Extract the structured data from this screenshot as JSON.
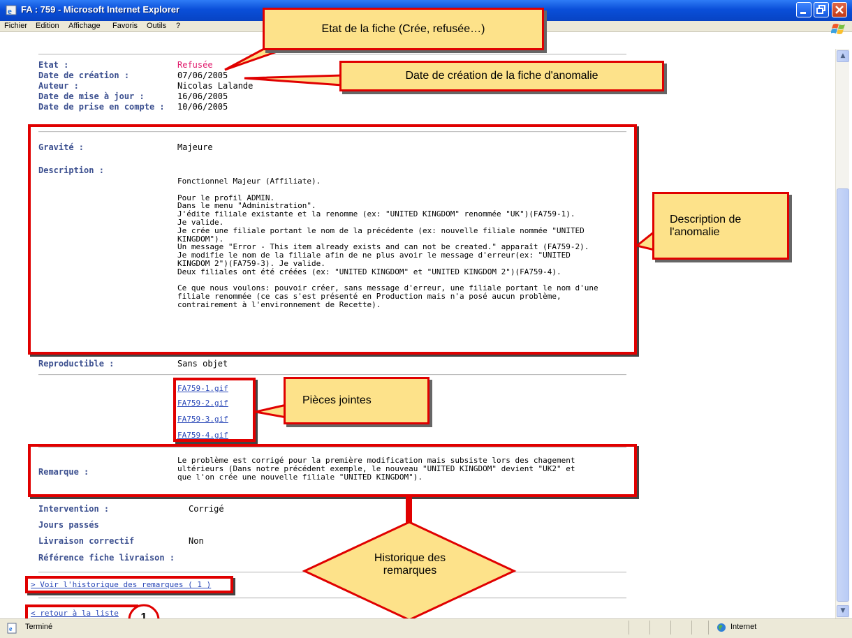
{
  "window": {
    "title": "FA : 759 - Microsoft Internet Explorer"
  },
  "menu": [
    "Fichier",
    "Edition",
    "Affichage",
    "Favoris",
    "Outils",
    "?"
  ],
  "fields_top": {
    "etat": {
      "label": "Etat :",
      "value": "Refusée",
      "color": "#e0196b"
    },
    "date_creation": {
      "label": "Date de création :",
      "value": "07/06/2005"
    },
    "auteur": {
      "label": "Auteur :",
      "value": "Nicolas Lalande"
    },
    "date_maj": {
      "label": "Date de mise à jour :",
      "value": "16/06/2005"
    },
    "date_prise": {
      "label": "Date de prise en compte :",
      "value": "10/06/2005"
    }
  },
  "gravite": {
    "label": "Gravité :",
    "value": "Majeure"
  },
  "description": {
    "label": "Description :",
    "text": "Fonctionnel Majeur (Affiliate).\n\nPour le profil ADMIN.\nDans le menu \"Administration\".\nJ'édite filiale existante et la renomme (ex: \"UNITED KINGDOM\" renommée \"UK\")(FA759-1).\nJe valide.\nJe crée une filiale portant le nom de la précédente (ex: nouvelle filiale nommée \"UNITED\nKINGDOM\").\nUn message \"Error - This item already exists and can not be created.\" apparaît (FA759-2).\nJe modifie le nom de la filiale afin de ne plus avoir le message d'erreur(ex: \"UNITED\nKINGDOM 2\")(FA759-3). Je valide.\nDeux filiales ont été créées (ex: \"UNITED KINGDOM\" et \"UNITED KINGDOM 2\")(FA759-4).\n\nCe que nous voulons: pouvoir créer, sans message d'erreur, une filiale portant le nom d'une\nfiliale renommée (ce cas s'est présenté en Production mais n'a posé aucun problème,\ncontrairement à l'environnement de Recette)."
  },
  "reproductible": {
    "label": "Reproductible :",
    "value": "Sans objet"
  },
  "attachments": [
    "FA759-1.gif",
    "FA759-2.gif",
    "FA759-3.gif",
    "FA759-4.gif"
  ],
  "remarque": {
    "label": "Remarque :",
    "text": "Le problème est corrigé pour la première modification mais subsiste lors des chagement\nultérieurs (Dans notre précédent exemple, le nouveau \"UNITED KINGDOM\" devient \"UK2\" et\nque l'on crée une nouvelle filiale \"UNITED KINGDOM\")."
  },
  "fields_bottom": {
    "intervention": {
      "label": "Intervention :",
      "value": "Corrigé"
    },
    "jours": {
      "label": "Jours passés",
      "value": ""
    },
    "livraison": {
      "label": "Livraison correctif",
      "value": "Non"
    },
    "reference": {
      "label": "Référence fiche livraison :",
      "value": ""
    }
  },
  "links": {
    "historique": "> Voir l'historique des remarques ( 1 )",
    "retour": "< retour à la liste"
  },
  "callouts": {
    "etat": "Etat de la fiche (Crée, refusée…)",
    "date": "Date de création de la fiche d'anomalie",
    "description": "Description de l'anomalie",
    "pieces": "Pièces jointes",
    "historique": "Historique des remarques",
    "marker": "1"
  },
  "statusbar": {
    "left": "Terminé",
    "zone": "Internet"
  },
  "colors": {
    "annotation_red": "#e00000",
    "callout_fill": "#fde28a",
    "label_blue": "#3b4f8f",
    "xp_blue": "#0a4fd9"
  }
}
